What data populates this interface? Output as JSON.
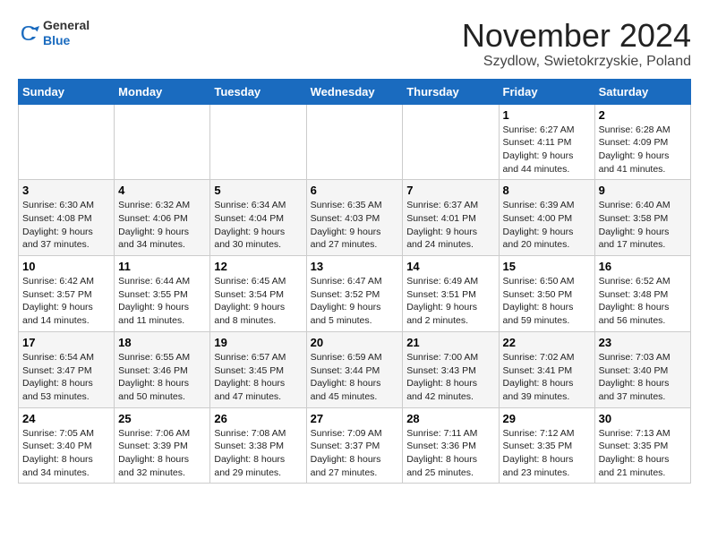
{
  "logo": {
    "general": "General",
    "blue": "Blue"
  },
  "header": {
    "month": "November 2024",
    "location": "Szydlow, Swietokrzyskie, Poland"
  },
  "days_of_week": [
    "Sunday",
    "Monday",
    "Tuesday",
    "Wednesday",
    "Thursday",
    "Friday",
    "Saturday"
  ],
  "weeks": [
    [
      {
        "day": "",
        "info": ""
      },
      {
        "day": "",
        "info": ""
      },
      {
        "day": "",
        "info": ""
      },
      {
        "day": "",
        "info": ""
      },
      {
        "day": "",
        "info": ""
      },
      {
        "day": "1",
        "info": "Sunrise: 6:27 AM\nSunset: 4:11 PM\nDaylight: 9 hours and 44 minutes."
      },
      {
        "day": "2",
        "info": "Sunrise: 6:28 AM\nSunset: 4:09 PM\nDaylight: 9 hours and 41 minutes."
      }
    ],
    [
      {
        "day": "3",
        "info": "Sunrise: 6:30 AM\nSunset: 4:08 PM\nDaylight: 9 hours and 37 minutes."
      },
      {
        "day": "4",
        "info": "Sunrise: 6:32 AM\nSunset: 4:06 PM\nDaylight: 9 hours and 34 minutes."
      },
      {
        "day": "5",
        "info": "Sunrise: 6:34 AM\nSunset: 4:04 PM\nDaylight: 9 hours and 30 minutes."
      },
      {
        "day": "6",
        "info": "Sunrise: 6:35 AM\nSunset: 4:03 PM\nDaylight: 9 hours and 27 minutes."
      },
      {
        "day": "7",
        "info": "Sunrise: 6:37 AM\nSunset: 4:01 PM\nDaylight: 9 hours and 24 minutes."
      },
      {
        "day": "8",
        "info": "Sunrise: 6:39 AM\nSunset: 4:00 PM\nDaylight: 9 hours and 20 minutes."
      },
      {
        "day": "9",
        "info": "Sunrise: 6:40 AM\nSunset: 3:58 PM\nDaylight: 9 hours and 17 minutes."
      }
    ],
    [
      {
        "day": "10",
        "info": "Sunrise: 6:42 AM\nSunset: 3:57 PM\nDaylight: 9 hours and 14 minutes."
      },
      {
        "day": "11",
        "info": "Sunrise: 6:44 AM\nSunset: 3:55 PM\nDaylight: 9 hours and 11 minutes."
      },
      {
        "day": "12",
        "info": "Sunrise: 6:45 AM\nSunset: 3:54 PM\nDaylight: 9 hours and 8 minutes."
      },
      {
        "day": "13",
        "info": "Sunrise: 6:47 AM\nSunset: 3:52 PM\nDaylight: 9 hours and 5 minutes."
      },
      {
        "day": "14",
        "info": "Sunrise: 6:49 AM\nSunset: 3:51 PM\nDaylight: 9 hours and 2 minutes."
      },
      {
        "day": "15",
        "info": "Sunrise: 6:50 AM\nSunset: 3:50 PM\nDaylight: 8 hours and 59 minutes."
      },
      {
        "day": "16",
        "info": "Sunrise: 6:52 AM\nSunset: 3:48 PM\nDaylight: 8 hours and 56 minutes."
      }
    ],
    [
      {
        "day": "17",
        "info": "Sunrise: 6:54 AM\nSunset: 3:47 PM\nDaylight: 8 hours and 53 minutes."
      },
      {
        "day": "18",
        "info": "Sunrise: 6:55 AM\nSunset: 3:46 PM\nDaylight: 8 hours and 50 minutes."
      },
      {
        "day": "19",
        "info": "Sunrise: 6:57 AM\nSunset: 3:45 PM\nDaylight: 8 hours and 47 minutes."
      },
      {
        "day": "20",
        "info": "Sunrise: 6:59 AM\nSunset: 3:44 PM\nDaylight: 8 hours and 45 minutes."
      },
      {
        "day": "21",
        "info": "Sunrise: 7:00 AM\nSunset: 3:43 PM\nDaylight: 8 hours and 42 minutes."
      },
      {
        "day": "22",
        "info": "Sunrise: 7:02 AM\nSunset: 3:41 PM\nDaylight: 8 hours and 39 minutes."
      },
      {
        "day": "23",
        "info": "Sunrise: 7:03 AM\nSunset: 3:40 PM\nDaylight: 8 hours and 37 minutes."
      }
    ],
    [
      {
        "day": "24",
        "info": "Sunrise: 7:05 AM\nSunset: 3:40 PM\nDaylight: 8 hours and 34 minutes."
      },
      {
        "day": "25",
        "info": "Sunrise: 7:06 AM\nSunset: 3:39 PM\nDaylight: 8 hours and 32 minutes."
      },
      {
        "day": "26",
        "info": "Sunrise: 7:08 AM\nSunset: 3:38 PM\nDaylight: 8 hours and 29 minutes."
      },
      {
        "day": "27",
        "info": "Sunrise: 7:09 AM\nSunset: 3:37 PM\nDaylight: 8 hours and 27 minutes."
      },
      {
        "day": "28",
        "info": "Sunrise: 7:11 AM\nSunset: 3:36 PM\nDaylight: 8 hours and 25 minutes."
      },
      {
        "day": "29",
        "info": "Sunrise: 7:12 AM\nSunset: 3:35 PM\nDaylight: 8 hours and 23 minutes."
      },
      {
        "day": "30",
        "info": "Sunrise: 7:13 AM\nSunset: 3:35 PM\nDaylight: 8 hours and 21 minutes."
      }
    ]
  ]
}
